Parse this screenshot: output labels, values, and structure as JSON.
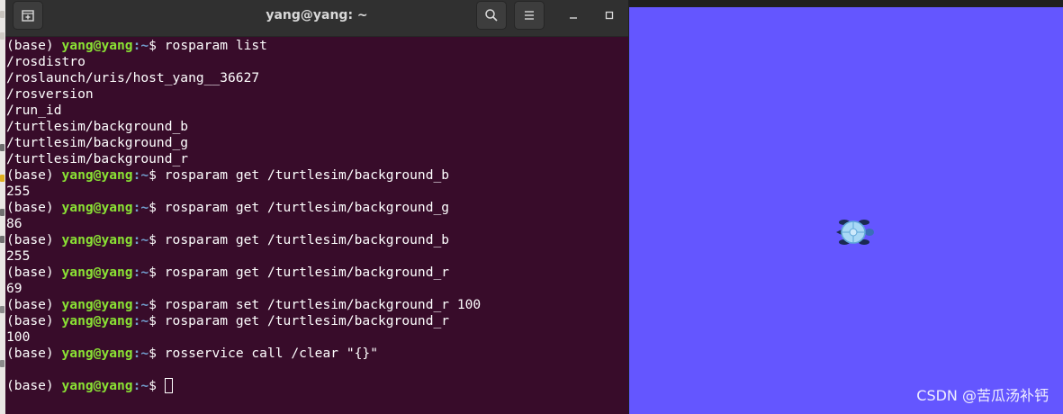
{
  "terminal": {
    "title": "yang@yang: ~",
    "prompt": {
      "env": "(base) ",
      "user_host": "yang@yang",
      "path": ":~",
      "symbol": "$ "
    },
    "lines": [
      {
        "type": "cmd",
        "text": "rosparam list"
      },
      {
        "type": "out",
        "text": "/rosdistro"
      },
      {
        "type": "out",
        "text": "/roslaunch/uris/host_yang__36627"
      },
      {
        "type": "out",
        "text": "/rosversion"
      },
      {
        "type": "out",
        "text": "/run_id"
      },
      {
        "type": "out",
        "text": "/turtlesim/background_b"
      },
      {
        "type": "out",
        "text": "/turtlesim/background_g"
      },
      {
        "type": "out",
        "text": "/turtlesim/background_r"
      },
      {
        "type": "cmd",
        "text": "rosparam get /turtlesim/background_b"
      },
      {
        "type": "out",
        "text": "255"
      },
      {
        "type": "cmd",
        "text": "rosparam get /turtlesim/background_g"
      },
      {
        "type": "out",
        "text": "86"
      },
      {
        "type": "cmd",
        "text": "rosparam get /turtlesim/background_b"
      },
      {
        "type": "out",
        "text": "255"
      },
      {
        "type": "cmd",
        "text": "rosparam get /turtlesim/background_r"
      },
      {
        "type": "out",
        "text": "69"
      },
      {
        "type": "cmd",
        "text": "rosparam set /turtlesim/background_r 100"
      },
      {
        "type": "cmd",
        "text": "rosparam get /turtlesim/background_r"
      },
      {
        "type": "out",
        "text": "100"
      },
      {
        "type": "cmd",
        "text": "rosservice call /clear \"{}\""
      },
      {
        "type": "out",
        "text": ""
      },
      {
        "type": "cmd",
        "text": "",
        "cursor": true
      }
    ],
    "icons": {
      "new_tab": "new-tab-icon",
      "search": "search-icon",
      "menu": "hamburger-menu-icon",
      "minimize": "minimize-icon",
      "maximize": "maximize-icon"
    },
    "colors": {
      "background": "#380c2a",
      "titlebar": "#303030",
      "prompt_user": "#8ae234",
      "prompt_path": "#729fcf",
      "text": "#ffffff"
    }
  },
  "turtlesim": {
    "background_color": "#6456ff",
    "turtle_icon": "turtle-icon"
  },
  "watermark": "CSDN @苦瓜汤补钙"
}
